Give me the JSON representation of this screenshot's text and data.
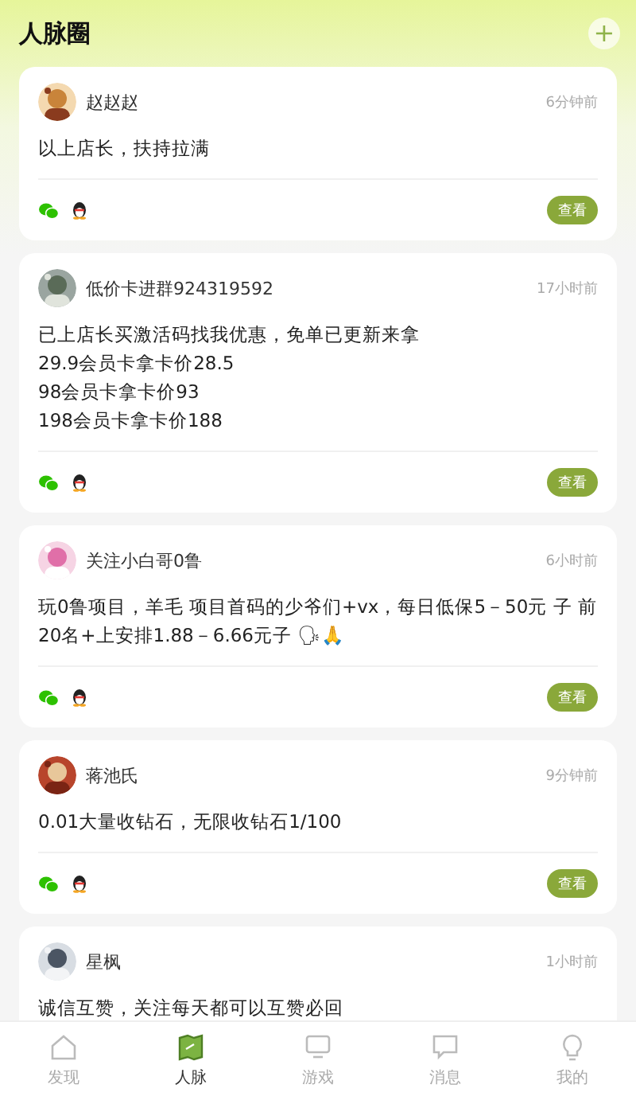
{
  "header": {
    "title": "人脉圈",
    "add_button": "+"
  },
  "posts": [
    {
      "name": "赵赵赵",
      "time": "6分钟前",
      "lines": [
        "以上店长，扶持拉满"
      ],
      "button": "查看"
    },
    {
      "name": "低价卡进群924319592",
      "time": "17小时前",
      "lines": [
        "已上店长买激活码找我优惠，免单已更新来拿",
        "29.9会员卡拿卡价28.5",
        "98会员卡拿卡价93",
        "198会员卡拿卡价188"
      ],
      "button": "查看"
    },
    {
      "name": "关注小白哥0鲁",
      "time": "6小时前",
      "lines": [
        "玩0鲁项目，羊毛 项目首码的少爷们+vx，每日低保5－50元 子 前20名+上安排1.88－6.66元子 🗣🙏"
      ],
      "button": "查看"
    },
    {
      "name": "蒋池氏",
      "time": "9分钟前",
      "lines": [
        "0.01大量收钻石，无限收钻石1/100"
      ],
      "button": "查看"
    },
    {
      "name": "星枫",
      "time": "1小时前",
      "lines": [
        "诚信互赞，关注每天都可以互赞必回"
      ]
    }
  ],
  "tabs": [
    {
      "kind": "home",
      "label": "发现",
      "selected": false
    },
    {
      "kind": "map",
      "label": "人脉",
      "selected": true
    },
    {
      "kind": "monitor",
      "label": "游戏",
      "selected": false
    },
    {
      "kind": "chat",
      "label": "消息",
      "selected": false
    },
    {
      "kind": "bulb",
      "label": "我的",
      "selected": false
    }
  ]
}
